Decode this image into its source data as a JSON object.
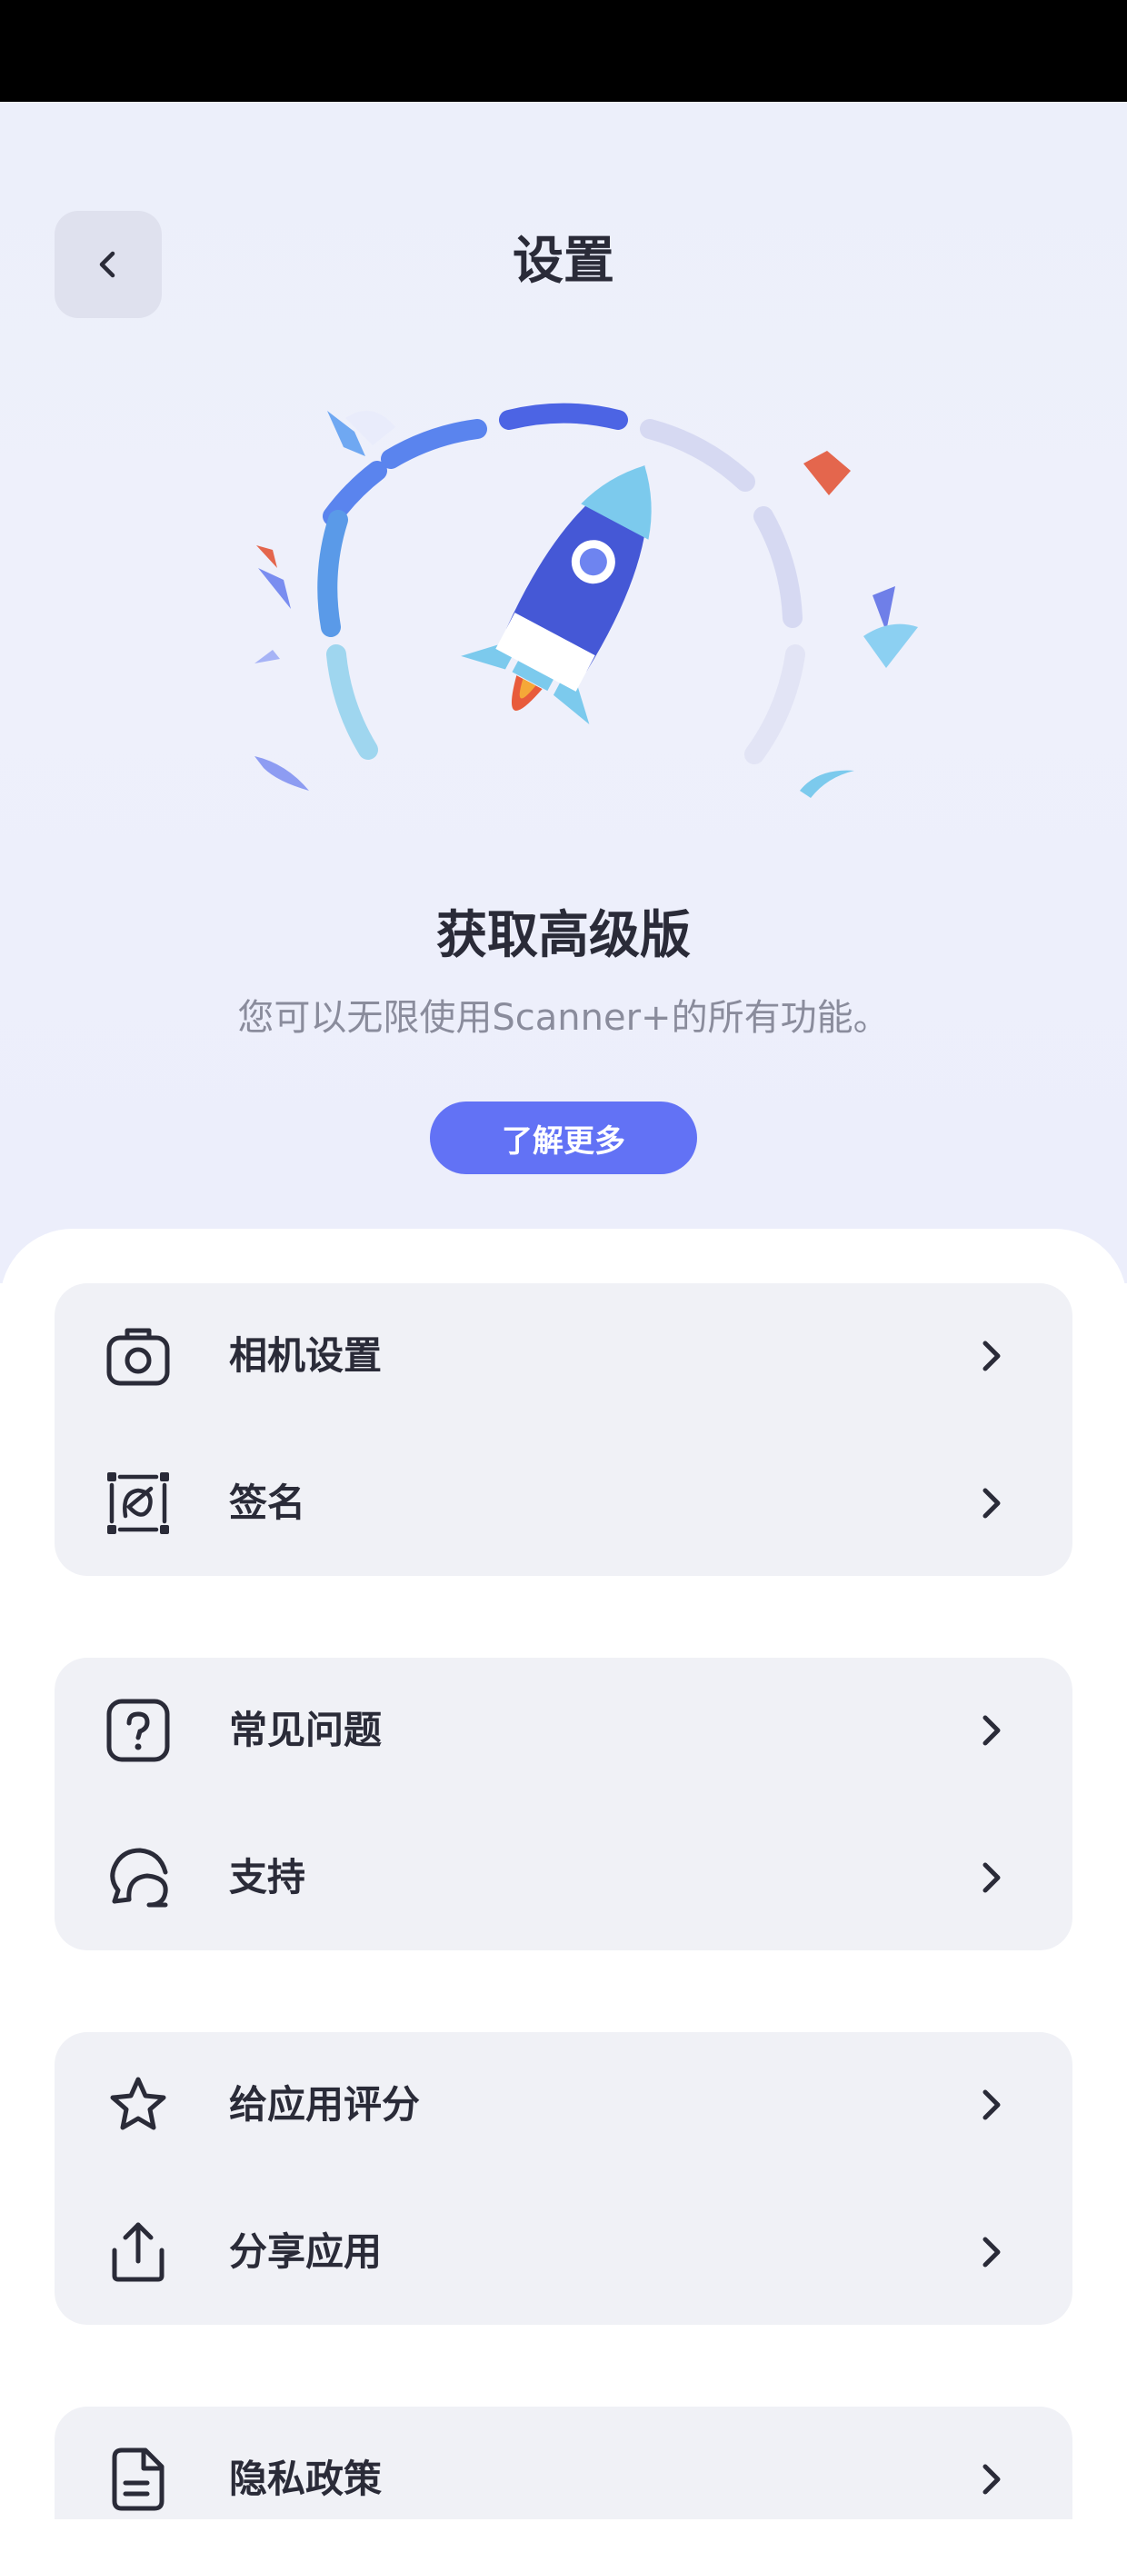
{
  "header": {
    "title": "设置"
  },
  "promo": {
    "title": "获取高级版",
    "subtitle": "您可以无限使用Scanner+的所有功能。",
    "button_label": "了解更多"
  },
  "settings_groups": [
    {
      "items": [
        {
          "label": "相机设置",
          "icon": "camera-icon"
        },
        {
          "label": "签名",
          "icon": "signature-icon"
        }
      ]
    },
    {
      "items": [
        {
          "label": "常见问题",
          "icon": "question-icon"
        },
        {
          "label": "支持",
          "icon": "chat-icon"
        }
      ]
    },
    {
      "items": [
        {
          "label": "给应用评分",
          "icon": "star-icon"
        },
        {
          "label": "分享应用",
          "icon": "share-icon"
        }
      ]
    },
    {
      "items": [
        {
          "label": "隐私政策",
          "icon": "document-icon"
        }
      ]
    }
  ],
  "colors": {
    "accent": "#6272f5",
    "background": "#eceffa",
    "card": "#f0f1f6",
    "text": "#2a2b38",
    "subtext": "#8a8c9c"
  }
}
